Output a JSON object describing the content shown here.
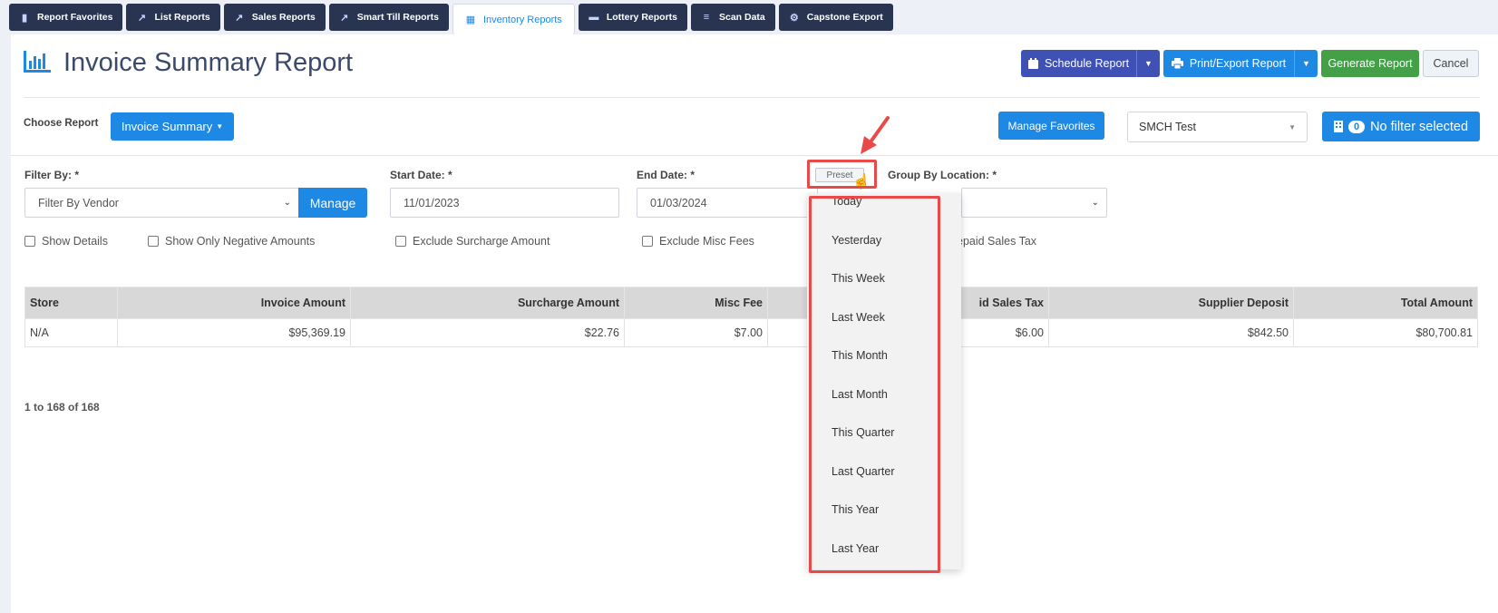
{
  "tabs": [
    {
      "label": "Report Favorites",
      "icon": "bookmark-icon",
      "active": false
    },
    {
      "label": "List Reports",
      "icon": "chart-line-icon",
      "active": false
    },
    {
      "label": "Sales Reports",
      "icon": "chart-line-icon",
      "active": false
    },
    {
      "label": "Smart Till Reports",
      "icon": "chart-line-icon",
      "active": false
    },
    {
      "label": "Inventory Reports",
      "icon": "warehouse-icon",
      "active": true
    },
    {
      "label": "Lottery Reports",
      "icon": "ticket-icon",
      "active": false
    },
    {
      "label": "Scan Data",
      "icon": "list-icon",
      "active": false
    },
    {
      "label": "Capstone Export",
      "icon": "cogs-icon",
      "active": false
    }
  ],
  "header": {
    "title": "Invoice Summary Report",
    "title_icon": "bar-chart-icon",
    "schedule_label": "Schedule Report",
    "print_label": "Print/Export Report",
    "generate_label": "Generate Report",
    "cancel_label": "Cancel"
  },
  "toolbar": {
    "choose_label": "Choose Report",
    "report_select": "Invoice Summary",
    "manage_favorites": "Manage Favorites",
    "store": "SMCH Test",
    "filter_count": "0",
    "filter_label": "No filter selected"
  },
  "filters": {
    "filter_by_label": "Filter By: *",
    "filter_by_value": "Filter By Vendor",
    "manage_label": "Manage",
    "start_label": "Start Date: *",
    "start_value": "11/01/2023",
    "end_label": "End Date: *",
    "end_value": "01/03/2024",
    "preset_label": "Preset",
    "group_label": "Group By Location: *"
  },
  "checkboxes": {
    "show_details": "Show Details",
    "negative_only": "Show Only Negative Amounts",
    "exclude_surcharge": "Exclude Surcharge Amount",
    "exclude_misc": "Exclude Misc Fees",
    "prepaid_partial": "epaid Sales Tax"
  },
  "table": {
    "headers": [
      "Store",
      "Invoice Amount",
      "Surcharge Amount",
      "Misc Fee",
      "",
      "id Sales Tax",
      "Supplier Deposit",
      "Total Amount"
    ],
    "rows": [
      [
        "N/A",
        "$95,369.19",
        "$22.76",
        "$7.00",
        "",
        "$6.00",
        "$842.50",
        "$80,700.81"
      ]
    ]
  },
  "pager": "1 to 168 of 168",
  "preset_menu": [
    "Today",
    "Yesterday",
    "This Week",
    "Last Week",
    "This Month",
    "Last Month",
    "This Quarter",
    "Last Quarter",
    "This Year",
    "Last Year"
  ],
  "colors": {
    "tab_dark": "#283450",
    "primary": "#1e88e5",
    "schedule": "#3f51b5",
    "generate": "#43a047",
    "annotation": "#e84a4a"
  }
}
